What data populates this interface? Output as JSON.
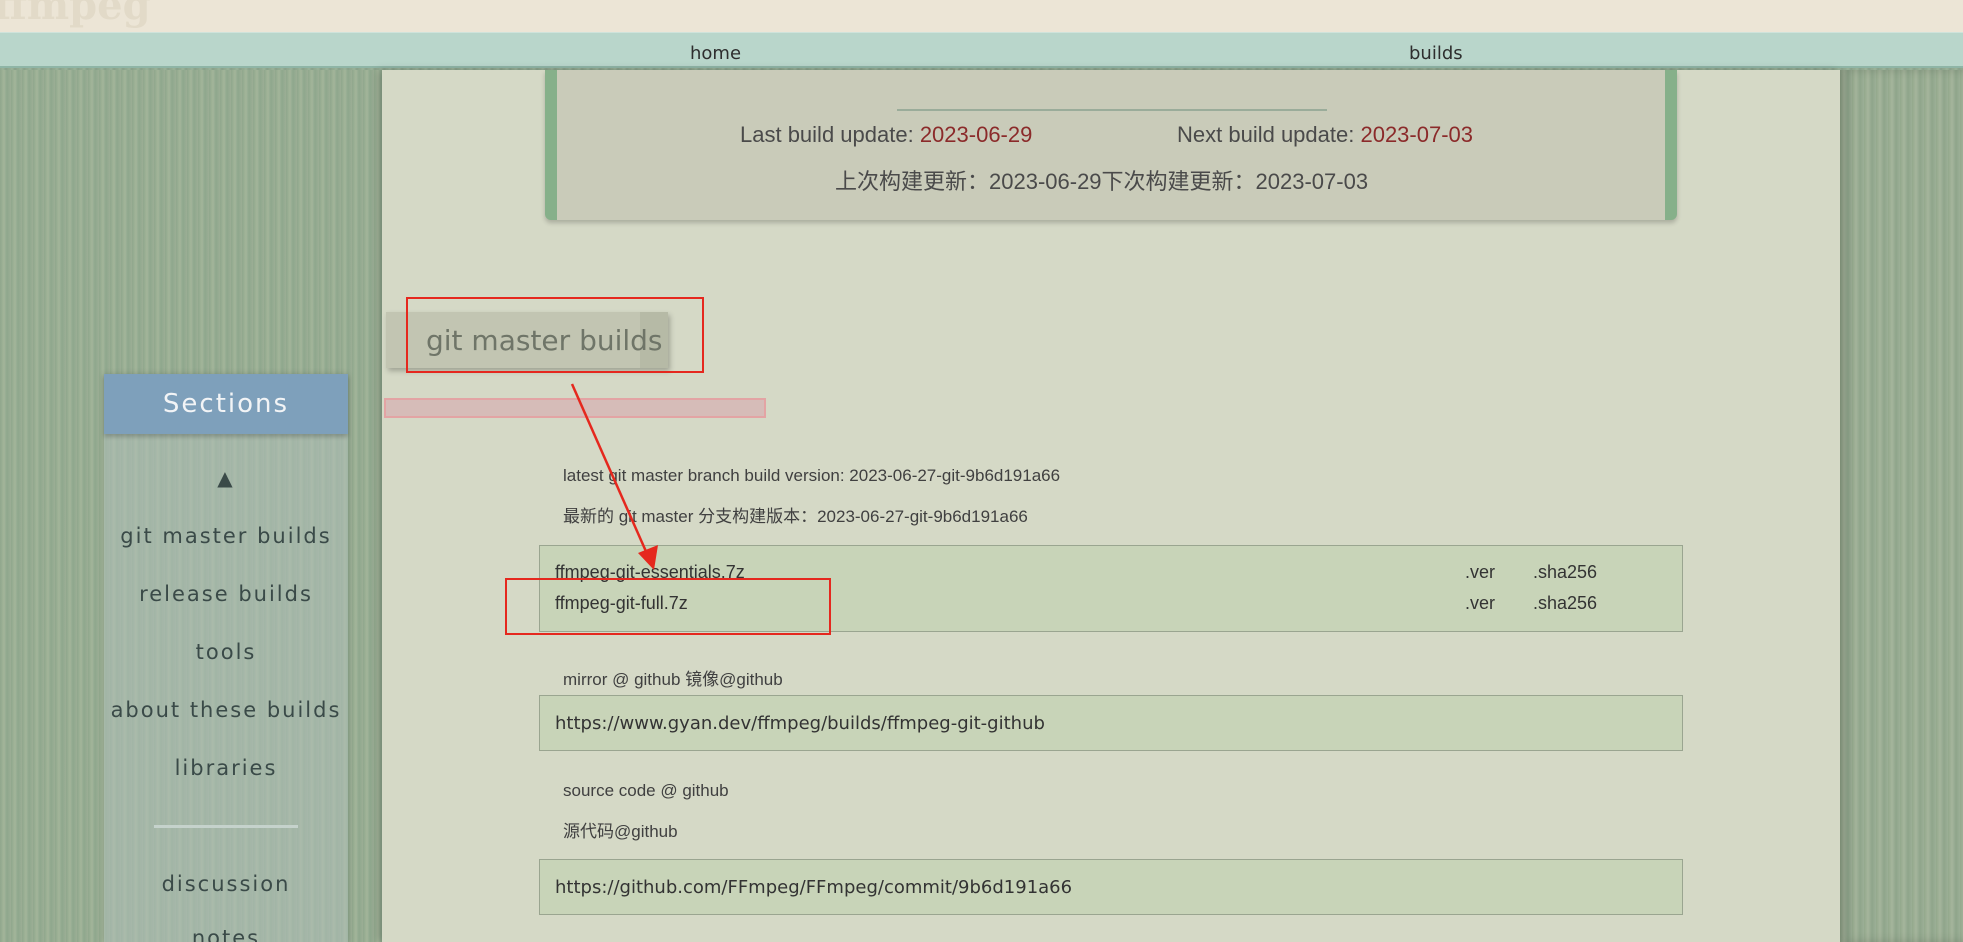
{
  "top_strip": {
    "logo_text": "ffmpeg"
  },
  "nav": {
    "home": "home",
    "builds": "builds"
  },
  "update": {
    "last_label": "Last build update: ",
    "last_value": "2023-06-29",
    "next_label": "Next build update: ",
    "next_value": "2023-07-03",
    "cn_line": "上次构建更新：2023-06-29下次构建更新：2023-07-03"
  },
  "sections": {
    "title": "Sections",
    "up": "▲",
    "items": [
      "git master builds",
      "release builds",
      "tools",
      "about these builds",
      "libraries",
      "discussion",
      "notes"
    ]
  },
  "section_heading": "git master builds",
  "info": {
    "latest_en": "latest git master branch build      version: 2023-06-27-git-9b6d191a66",
    "latest_cn": "最新的 git master 分支构建版本：2023-06-27-git-9b6d191a66",
    "mirror": "mirror @ github 镜像@github",
    "source_en": "source code @ github",
    "source_cn": "源代码@github"
  },
  "downloads": [
    {
      "name": "ffmpeg-git-essentials.7z",
      "ver": ".ver",
      "sha": ".sha256"
    },
    {
      "name": "ffmpeg-git-full.7z",
      "ver": ".ver",
      "sha": ".sha256"
    }
  ],
  "urls": {
    "mirror": "https://www.gyan.dev/ffmpeg/builds/ffmpeg-git-github",
    "source": "https://github.com/FFmpeg/FFmpeg/commit/9b6d191a66"
  },
  "colors": {
    "accent_red": "#8b2a2a",
    "highlight": "#e5281e",
    "sections_header": "#7ea0bb"
  }
}
